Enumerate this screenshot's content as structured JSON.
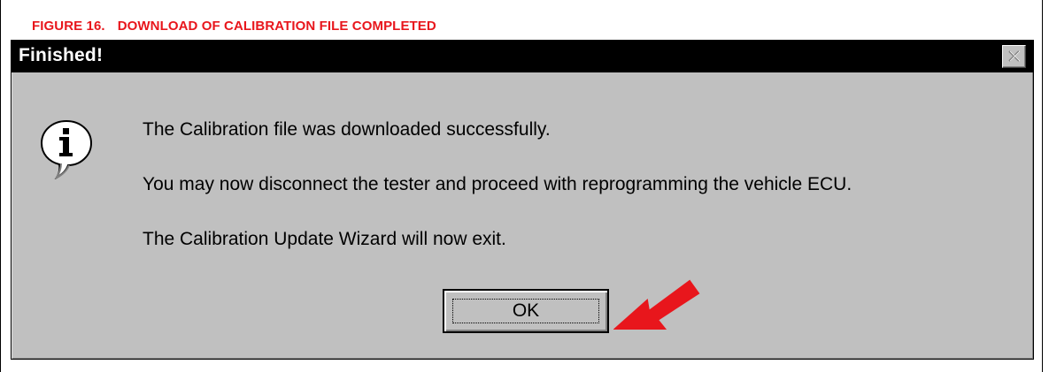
{
  "figure": {
    "number": "FIGURE 16.",
    "title": "DOWNLOAD OF CALIBRATION FILE COMPLETED"
  },
  "dialog": {
    "title": "Finished!",
    "close_icon": "close-icon",
    "info_icon": "info-icon",
    "messages": [
      "The Calibration file was downloaded successfully.",
      "You may now disconnect the tester and proceed with reprogramming the vehicle ECU.",
      "The Calibration Update Wizard will now exit."
    ],
    "ok_label": "OK"
  },
  "colors": {
    "caption_red": "#e8161c",
    "arrow_red": "#e8161c",
    "dialog_gray": "#c0c0c0",
    "titlebar": "#000000"
  }
}
